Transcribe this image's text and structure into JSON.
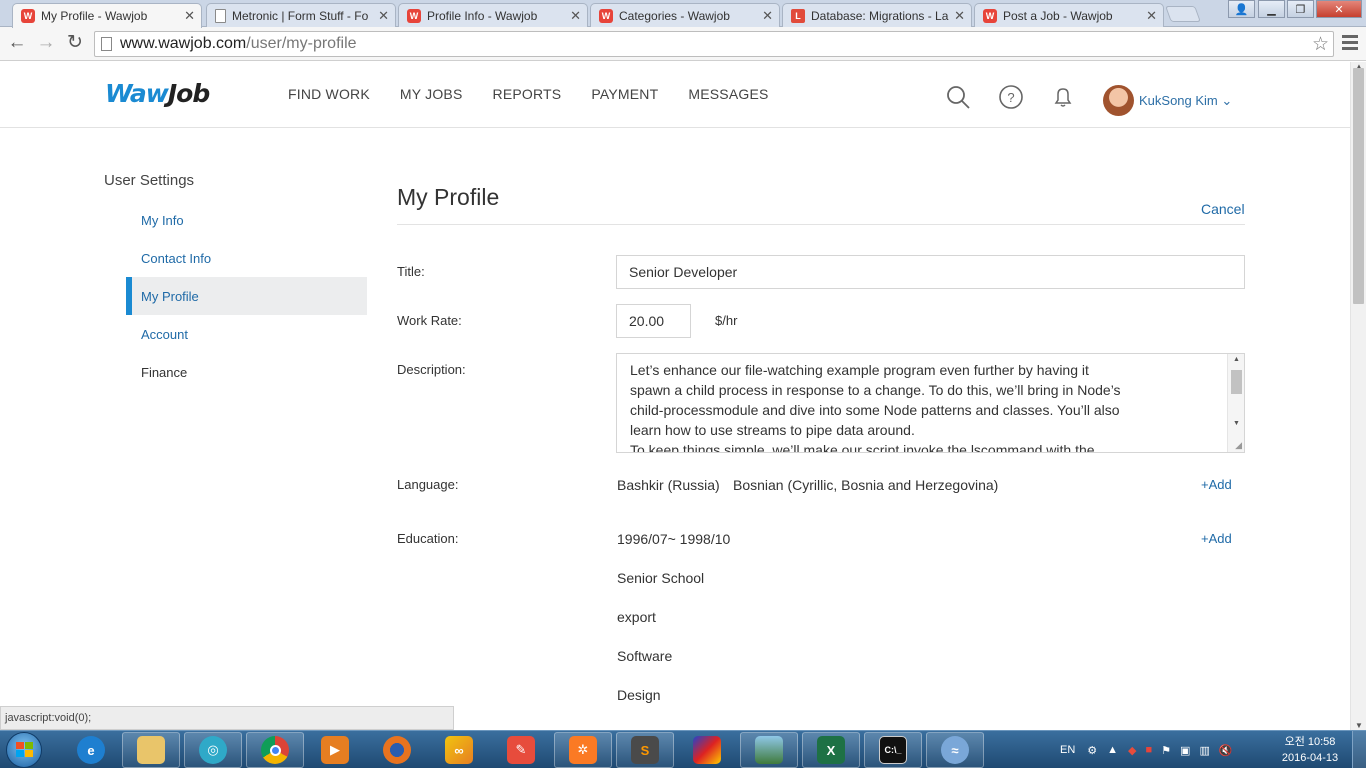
{
  "browser": {
    "tabs": [
      {
        "title": "My Profile - Wawjob",
        "icon": "wawjob-favicon",
        "active": true
      },
      {
        "title": "Metronic | Form Stuff - Fo",
        "icon": "document-favicon",
        "active": false
      },
      {
        "title": "Profile Info - Wawjob",
        "icon": "wawjob-favicon",
        "active": false
      },
      {
        "title": "Categories - Wawjob",
        "icon": "wawjob-favicon",
        "active": false
      },
      {
        "title": "Database: Migrations - La",
        "icon": "laravel-favicon",
        "active": false
      },
      {
        "title": "Post a Job - Wawjob",
        "icon": "wawjob-favicon",
        "active": false
      }
    ],
    "url_host": "www.wawjob.com",
    "url_path": "/user/my-profile",
    "status_text": "javascript:void(0);"
  },
  "header": {
    "logo_part1": "Waw",
    "logo_part2": "Job",
    "nav": [
      "FIND WORK",
      "MY JOBS",
      "REPORTS",
      "PAYMENT",
      "MESSAGES"
    ],
    "icons": [
      "search-icon",
      "help-icon",
      "bell-icon"
    ],
    "user_name": "KukSong Kim ⌄"
  },
  "sidebar": {
    "title": "User Settings",
    "items": [
      {
        "label": "My Info",
        "active": false
      },
      {
        "label": "Contact Info",
        "active": false
      },
      {
        "label": "My Profile",
        "active": true
      },
      {
        "label": "Account",
        "active": false
      },
      {
        "label": "Finance",
        "active": false
      }
    ]
  },
  "profile": {
    "heading": "My Profile",
    "cancel": "Cancel",
    "title_label": "Title:",
    "title_value": "Senior Developer",
    "rate_label": "Work Rate:",
    "rate_value": "20.00",
    "rate_unit": "$/hr",
    "description_label": "Description:",
    "description_lines": [
      "Let’s enhance our file-watching example program even further by having it",
      "spawn a child process in response to a change. To do this, we’ll bring in Node’s",
      "child-processmodule and dive into some Node patterns and classes. You’ll also",
      "learn how to use streams to pipe data around.",
      "To keep things simple, we’ll make our script invoke the lscommand with the"
    ],
    "language_label": "Language:",
    "languages": [
      "Bashkir (Russia)",
      "Bosnian (Cyrillic, Bosnia and Herzegovina)"
    ],
    "add_label": "+Add",
    "education_label": "Education:",
    "education_items": [
      "1996/07~ 1998/10",
      "Senior School",
      "export",
      "Software",
      "Design"
    ]
  },
  "taskbar": {
    "apps": [
      "internet-explorer",
      "file-explorer",
      "media-center",
      "chrome",
      "media-player",
      "firefox",
      "network-app",
      "notepad-app",
      "xampp",
      "sublime-text",
      "paint-app",
      "image-viewer",
      "excel",
      "command-prompt",
      "dolphin-app"
    ],
    "lang": "EN",
    "time": "오전 10:58",
    "date": "2016-04-13"
  },
  "colors": {
    "accent": "#1a8ad2",
    "link": "#1f6aa7",
    "taskbar": "#1f4a72"
  }
}
